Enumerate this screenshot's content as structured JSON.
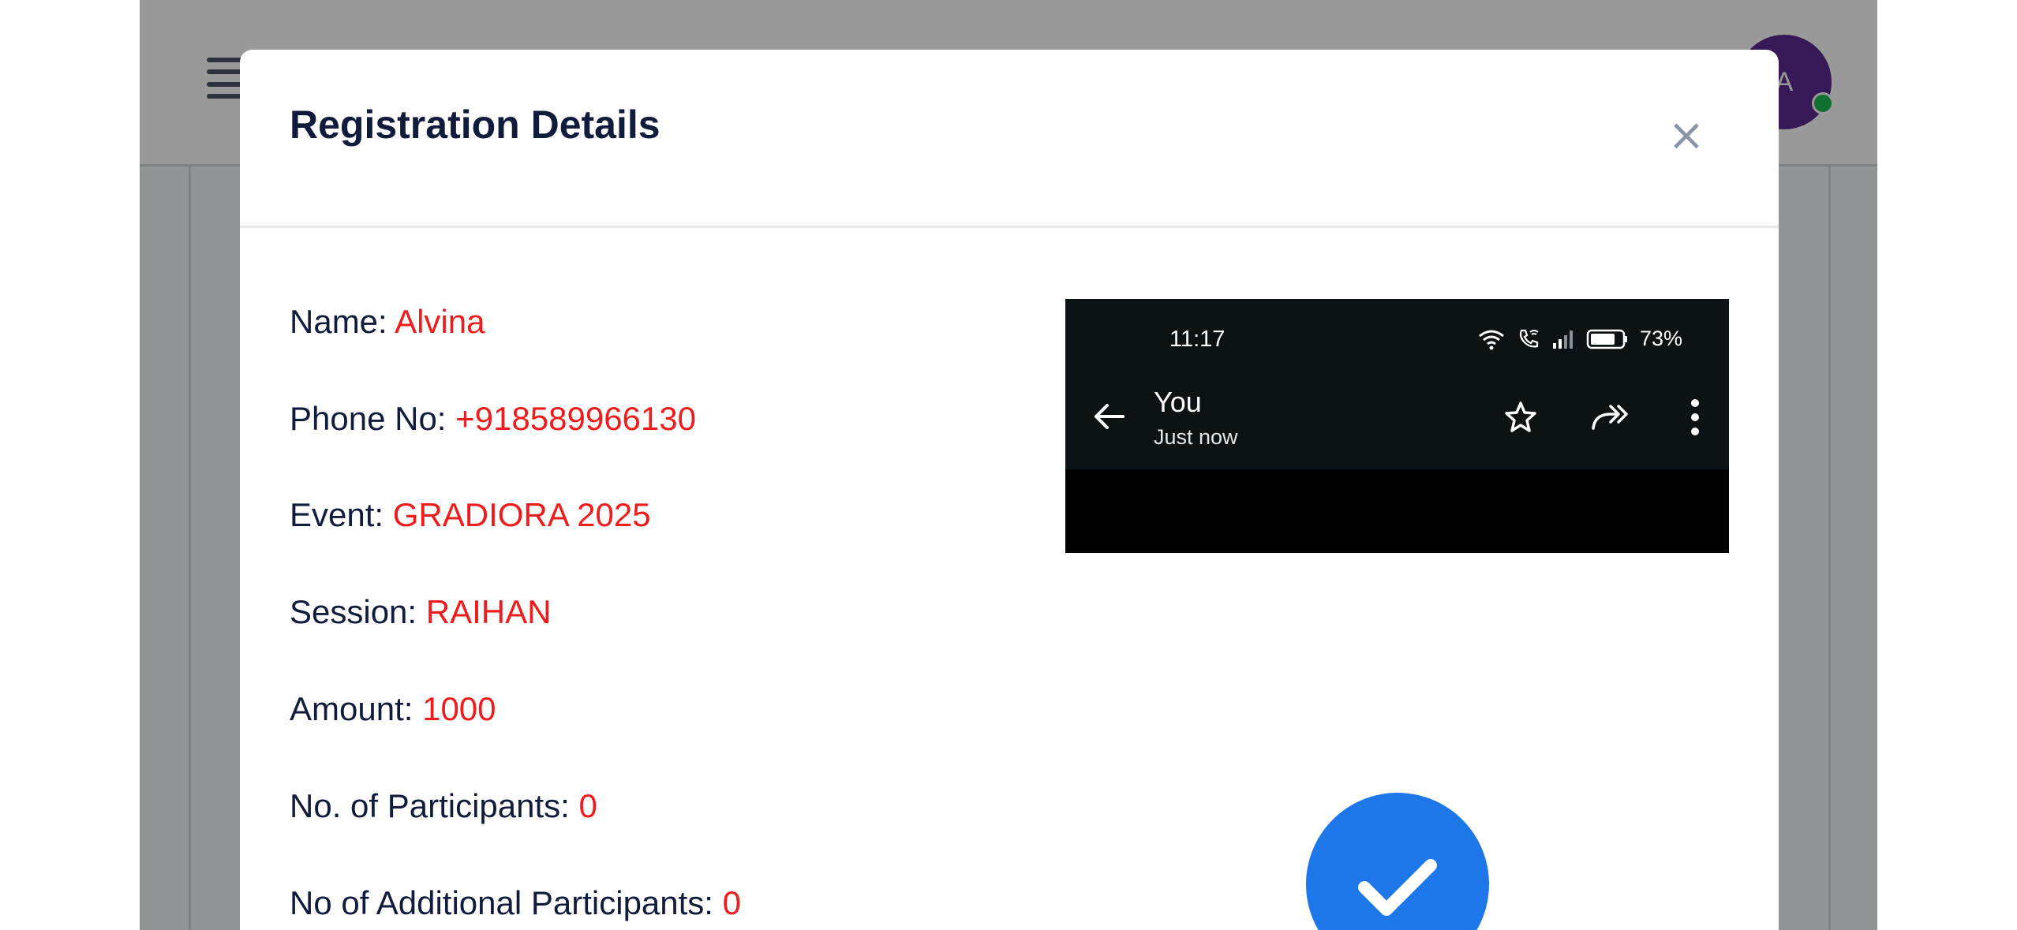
{
  "background_page": {
    "avatar_initial": "A"
  },
  "modal": {
    "title": "Registration Details",
    "close_symbol": "×",
    "details": [
      {
        "label": "Name:",
        "value": "Alvina"
      },
      {
        "label": "Phone No:",
        "value": "+918589966130"
      },
      {
        "label": "Event:",
        "value": "GRADIORA 2025"
      },
      {
        "label": "Session:",
        "value": "RAIHAN"
      },
      {
        "label": "Amount:",
        "value": "1000"
      },
      {
        "label": "No. of Participants:",
        "value": "0"
      },
      {
        "label": "No of Additional Participants:",
        "value": "0"
      }
    ],
    "payment_screenshot": {
      "time": "11:17",
      "battery_percent": "73%",
      "sender": "You",
      "sent_time": "Just now",
      "icons": [
        "wifi-icon",
        "wifi-call-icon",
        "signal-icon",
        "battery-icon",
        "back-arrow-icon",
        "star-icon",
        "forward-icon",
        "more-vert-icon"
      ]
    },
    "status_icon": "checkmark-icon"
  },
  "colors": {
    "value_text": "#ee1c1c",
    "label_text": "#111b3b",
    "check_circle": "#1e77e8",
    "avatar_bg": "#5b2a8f",
    "online_dot": "#1db954"
  }
}
